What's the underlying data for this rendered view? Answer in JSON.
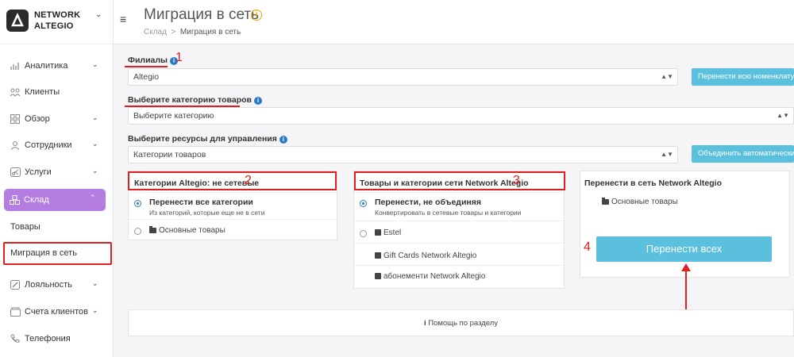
{
  "brand": {
    "line1": "NETWORK",
    "line2": "ALTEGIO"
  },
  "sidebar": {
    "items": [
      {
        "label": "Аналитика",
        "icon": "analytics-icon"
      },
      {
        "label": "Клиенты",
        "icon": "clients-icon"
      },
      {
        "label": "Обзор",
        "icon": "overview-icon"
      },
      {
        "label": "Сотрудники",
        "icon": "staff-icon"
      },
      {
        "label": "Услуги",
        "icon": "services-icon"
      },
      {
        "label": "Склад",
        "icon": "warehouse-icon"
      },
      {
        "label": "Лояльность",
        "icon": "loyalty-icon"
      },
      {
        "label": "Счета клиентов",
        "icon": "accounts-icon"
      },
      {
        "label": "Телефония",
        "icon": "phone-icon"
      }
    ],
    "sub_items": [
      "Товары",
      "Миграция в сеть"
    ]
  },
  "header": {
    "title": "Миграция в сеть",
    "breadcrumb_root": "Склад",
    "breadcrumb_sep": ">",
    "breadcrumb_current": "Миграция в сеть"
  },
  "form": {
    "branches_label": "Филиалы",
    "branches_value": "Altegio",
    "transfer_all_nomenclature": "Перенести всю номенклатуру",
    "category_label": "Выберите категорию товаров",
    "category_value": "Выберите категорию",
    "resources_label": "Выберите ресурсы для управления",
    "resources_value": "Категории товаров",
    "merge_auto": "Объединить автоматически"
  },
  "panels": {
    "left": {
      "title": "Категории Altegio: не сетевые",
      "opt1_title": "Перенести все категории",
      "opt1_sub": "Из категорий, которые еще не в сети",
      "opt2": "Основные товары"
    },
    "middle": {
      "title": "Товары и категории сети Network Altegio",
      "opt1_title": "Перенести, не объединяя",
      "opt1_sub": "Конвертировать в сетевые товары и категории",
      "items": [
        "Estel",
        "Gift Cards Network Altegio",
        "абонементи Network Altegio"
      ]
    },
    "right": {
      "title": "Перенести в сеть Network Altegio",
      "item": "Основные товары",
      "button": "Перенести всех"
    }
  },
  "annotations": {
    "n1": "1",
    "n2": "2",
    "n3": "3",
    "n4": "4"
  },
  "help": "Помощь по разделу",
  "colors": {
    "accent": "#b57de2",
    "button": "#5bc0de",
    "annotation": "#e02020"
  }
}
